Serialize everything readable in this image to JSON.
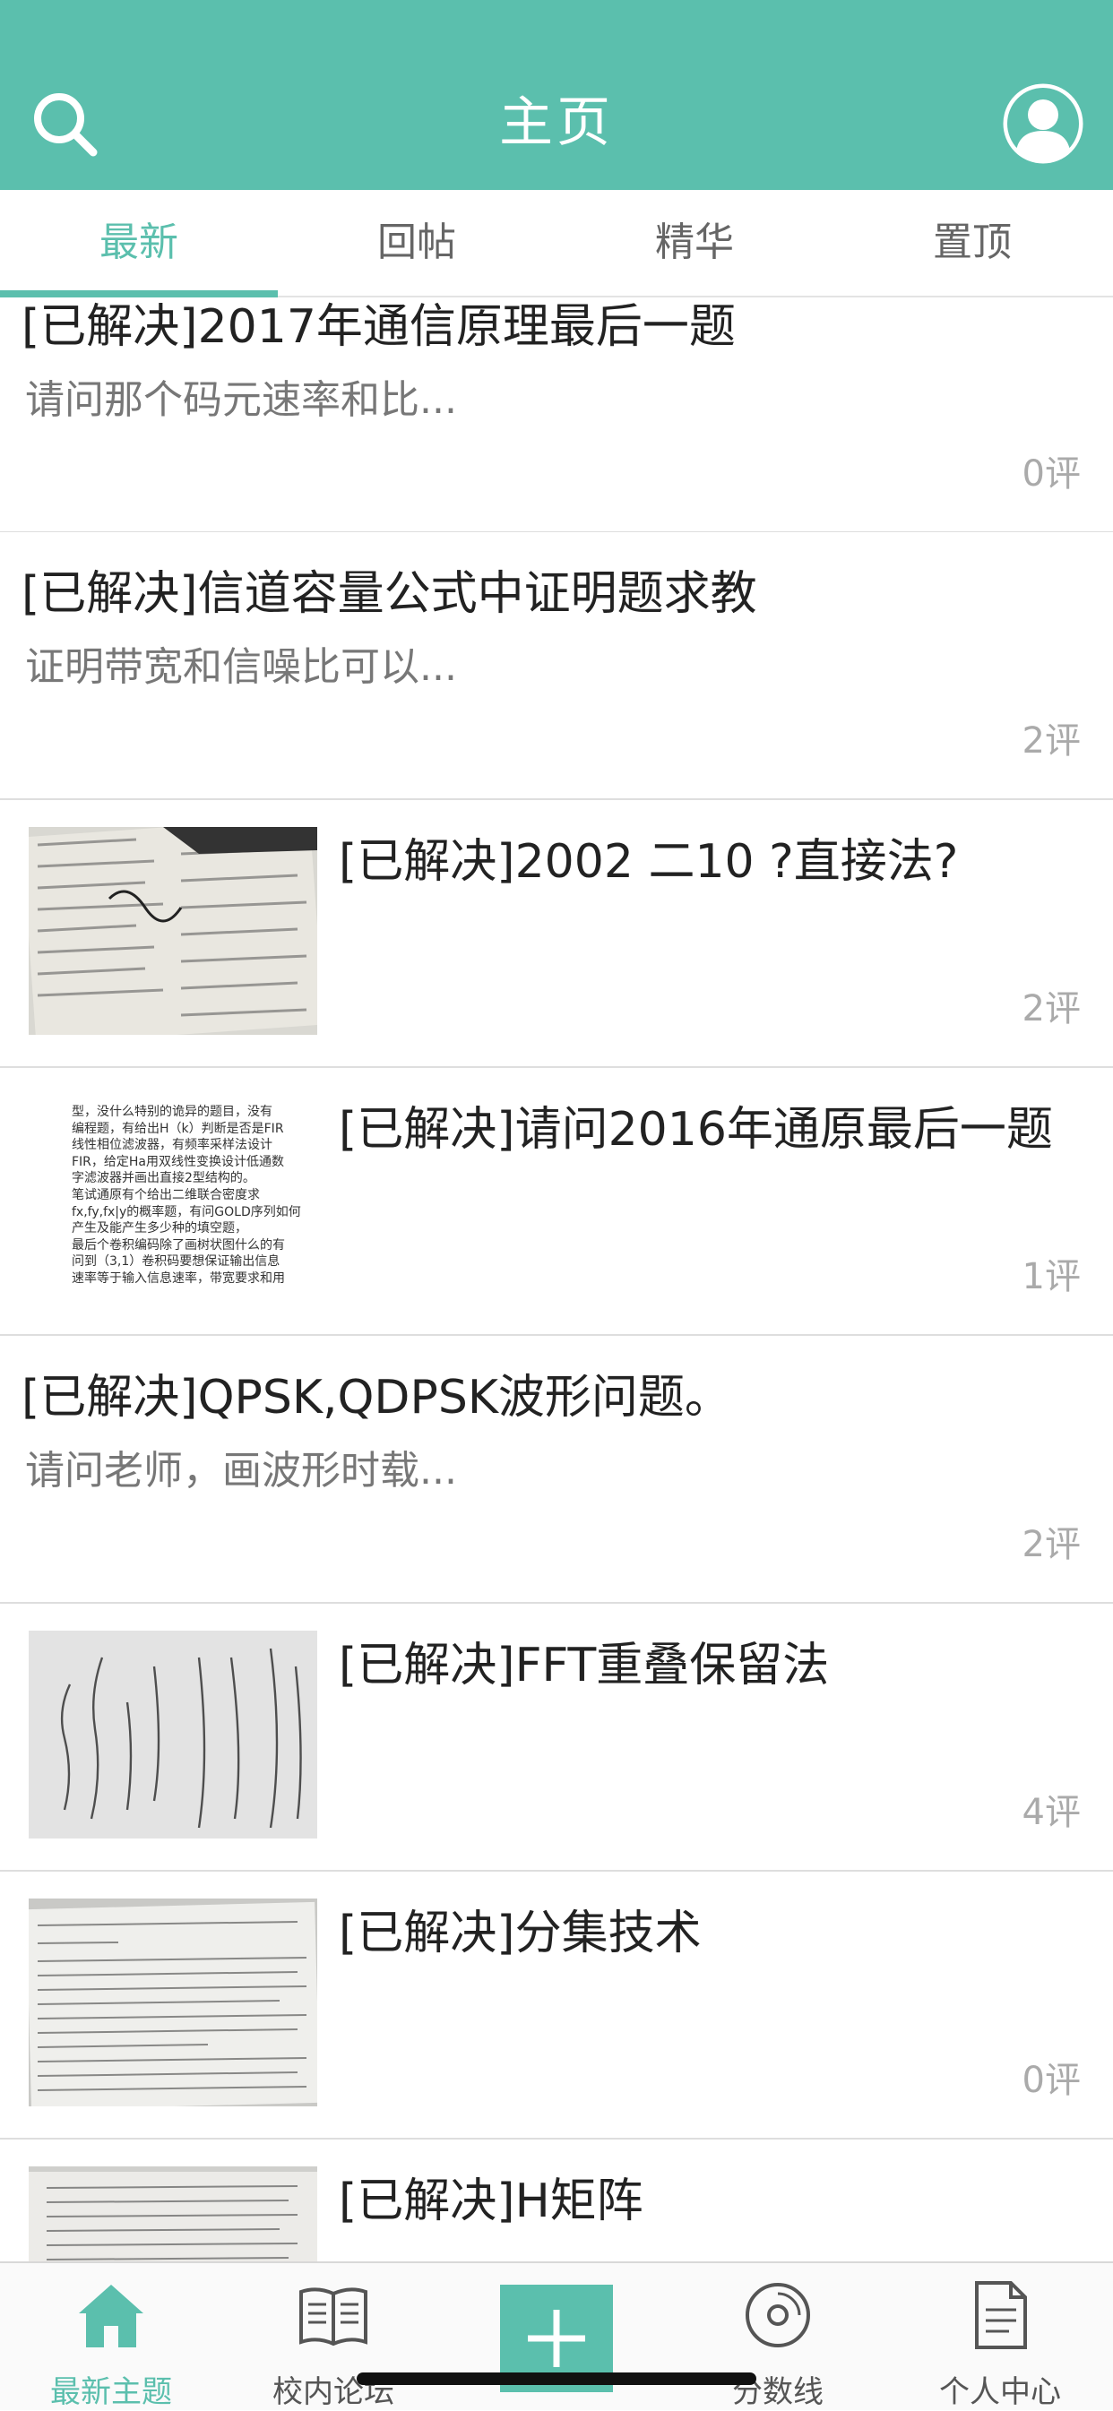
{
  "header": {
    "title": "主页",
    "accent": "#5bbfad",
    "left_icon": "search-icon",
    "right_icon": "avatar-icon"
  },
  "tabs": [
    {
      "label": "最新",
      "active": true
    },
    {
      "label": "回帖",
      "active": false
    },
    {
      "label": "精华",
      "active": false
    },
    {
      "label": "置顶",
      "active": false
    }
  ],
  "posts": [
    {
      "title": "[已解决]2017年通信原理最后一题",
      "excerpt": "请问那个码元速率和比...",
      "count": "0评"
    },
    {
      "title": "[已解决]信道容量公式中证明题求教",
      "excerpt": "证明带宽和信噪比可以...",
      "count": "2评"
    },
    {
      "title": "[已解决]2002 二10 ?直接法?",
      "count": "2评",
      "thumb": "photo-of-exam-paper"
    },
    {
      "title": "[已解决]请问2016年通原最后一题",
      "count": "1评",
      "thumb": "text-snippet",
      "thumb_text": [
        "型，没什么特别的诡异的题目，没有",
        "编程题，有给出H（k）判断是否是FIR",
        "线性相位滤波器，有频率采样法设计",
        "FIR，给定Ha用双线性变换设计低通数",
        "字滤波器并画出直接2型结构的。",
        "笔试通原有个给出二维联合密度求",
        "fx,fy,fx|y的概率题，有问GOLD序列如何",
        "产生及能产生多少种的填空题，",
        "最后个卷积编码除了画树状图什么的有",
        "问到（3,1）卷积码要想保证输出信息",
        "速率等于输入信息速率，带宽要求和用"
      ]
    },
    {
      "title": "[已解决]QPSK,QDPSK波形问题。",
      "excerpt": "请问老师，画波形时载...",
      "count": "2评"
    },
    {
      "title": "[已解决]FFT重叠保留法",
      "count": "4评",
      "thumb": "photo-of-handwritten-notes"
    },
    {
      "title": "[已解决]分集技术",
      "count": "0评",
      "thumb": "photo-of-textbook-page"
    },
    {
      "title": "[已解决]H矩阵",
      "count": "",
      "thumb": "photo-of-textbook-page"
    }
  ],
  "tabbar": [
    {
      "label": "最新主题",
      "icon": "home-icon",
      "active": true
    },
    {
      "label": "校内论坛",
      "icon": "book-icon",
      "active": false
    },
    {
      "label": "",
      "icon": "plus-icon",
      "active": false
    },
    {
      "label": "分数线",
      "icon": "disc-icon",
      "active": false
    },
    {
      "label": "个人中心",
      "icon": "document-icon",
      "active": false
    }
  ]
}
